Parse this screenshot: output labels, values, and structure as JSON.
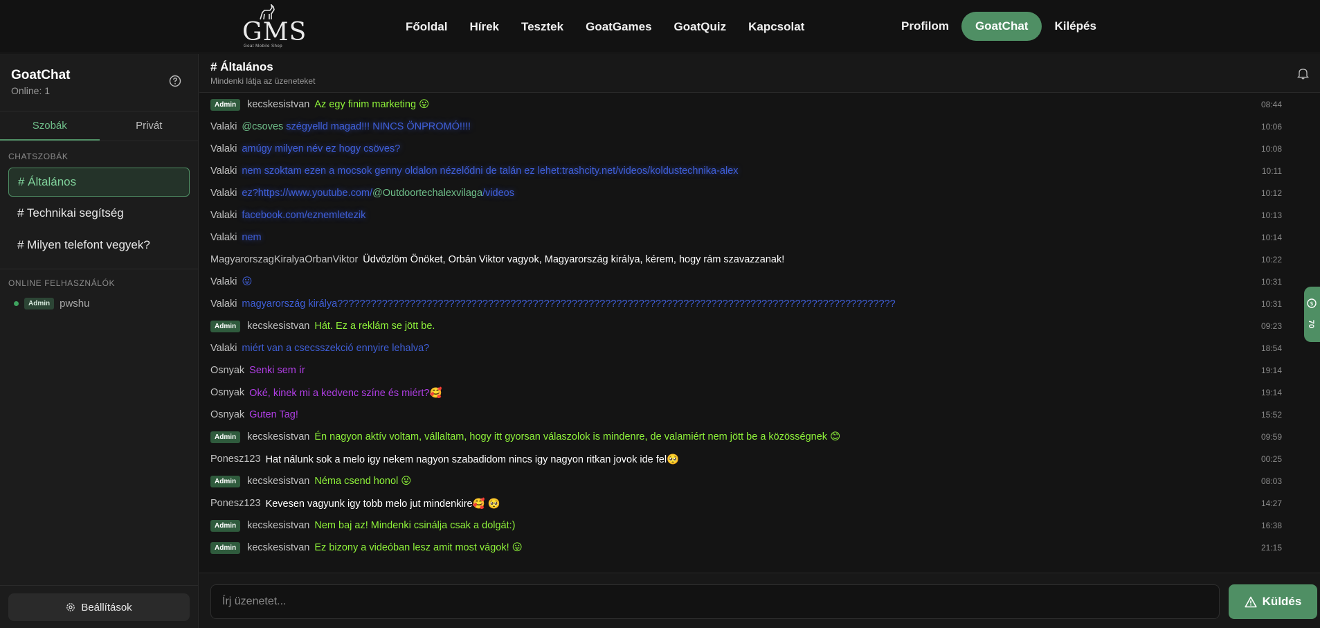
{
  "logo": {
    "text": "GMS",
    "subtitle": "Goat Mobile Shop"
  },
  "nav": {
    "center": [
      "Főoldal",
      "Hírek",
      "Tesztek",
      "GoatGames",
      "GoatQuiz",
      "Kapcsolat"
    ],
    "profile": "Profilom",
    "active": "GoatChat",
    "logout": "Kilépés"
  },
  "sidebar": {
    "title": "GoatChat",
    "online": "Online: 1",
    "tabs": [
      "Szobák",
      "Privát"
    ],
    "rooms_heading": "CHATSZOBÁK",
    "rooms": [
      "# Általános",
      "# Technikai segítség",
      "# Milyen telefont vegyek?"
    ],
    "online_heading": "ONLINE FELHASZNÁLÓK",
    "online_user": {
      "badge": "Admin",
      "name": "pwshu"
    },
    "settings": "Beállítások"
  },
  "channel": {
    "title": "# Általános",
    "subtitle": "Mindenki látja az üzeneteket"
  },
  "messages": [
    {
      "admin": true,
      "user": "kecskesistvan",
      "text": "Az egy finim marketing 😛",
      "time": "08:44"
    },
    {
      "admin": false,
      "user": "Valaki",
      "mention": "@csoves",
      "text": " szégyelld magad!!! NINCS ÖNPROMÓ!!!!",
      "time": "10:06"
    },
    {
      "admin": false,
      "user": "Valaki",
      "text": "amúgy milyen név ez hogy csöves?",
      "time": "10:08"
    },
    {
      "admin": false,
      "user": "Valaki",
      "text": "nem szoktam ezen a mocsok genny oldalon nézelődni de talán ez lehet:trashcity.net/videos/koldustechnika-alex",
      "time": "10:11"
    },
    {
      "admin": false,
      "user": "Valaki",
      "text": "ez?https://www.youtube.com/",
      "mention": "@Outdoortechalexvilaga",
      "text2": "/videos",
      "time": "10:12"
    },
    {
      "admin": false,
      "user": "Valaki",
      "text": "facebook.com/eznemletezik",
      "time": "10:13"
    },
    {
      "admin": false,
      "user": "Valaki",
      "text": "nem",
      "time": "10:14"
    },
    {
      "admin": false,
      "user": "MagyarorszagKiralyaOrbanViktor",
      "text": "Üdvözlöm Önöket, Orbán Viktor vagyok, Magyarország királya, kérem, hogy rám szavazzanak!",
      "time": "10:22"
    },
    {
      "admin": false,
      "user": "Valaki",
      "text": "😛",
      "time": "10:31"
    },
    {
      "admin": false,
      "user": "Valaki",
      "text": "magyarország királya????????????????????????????????????????????????????????????????????????????????????????????????????",
      "time": "10:31"
    },
    {
      "admin": true,
      "user": "kecskesistvan",
      "text": "Hát. Ez a reklám se jött be.",
      "time": "09:23"
    },
    {
      "admin": false,
      "user": "Valaki",
      "text": "miért van a csecsszekció ennyire lehalva?",
      "time": "18:54"
    },
    {
      "admin": false,
      "user": "Osnyak",
      "text": "Senki sem ír",
      "time": "19:14"
    },
    {
      "admin": false,
      "user": "Osnyak",
      "text": "Oké, kinek mi a kedvenc színe és miért?🥰",
      "time": "19:14"
    },
    {
      "admin": false,
      "user": "Osnyak",
      "text": "Guten Tag!",
      "time": "15:52"
    },
    {
      "admin": true,
      "user": "kecskesistvan",
      "text": "Én nagyon aktív voltam, vállaltam, hogy itt gyorsan válaszolok is mindenre, de valamiért nem jött be a közösségnek 😊",
      "time": "09:59"
    },
    {
      "admin": false,
      "user": "Ponesz123",
      "text": "Hat nálunk sok a melo igy nekem nagyon szabadidom nincs igy nagyon ritkan jovok ide fel🥺",
      "time": "00:25"
    },
    {
      "admin": true,
      "user": "kecskesistvan",
      "text": "Néma csend honol 😛",
      "time": "08:03"
    },
    {
      "admin": false,
      "user": "Ponesz123",
      "text": "Kevesen vagyunk igy tobb melo jut mindenkire🥰 🥺",
      "time": "14:27"
    },
    {
      "admin": true,
      "user": "kecskesistvan",
      "text": "Nem baj az! Mindenki csinálja csak a dolgát:)",
      "time": "16:38"
    },
    {
      "admin": true,
      "user": "kecskesistvan",
      "text": "Ez bizony a videóban lesz amit most vágok! 😛",
      "time": "21:15"
    }
  ],
  "admin_badge": "Admin",
  "side_tab": "70",
  "composer": {
    "placeholder": "Írj üzenetet...",
    "send": "Küldés"
  }
}
